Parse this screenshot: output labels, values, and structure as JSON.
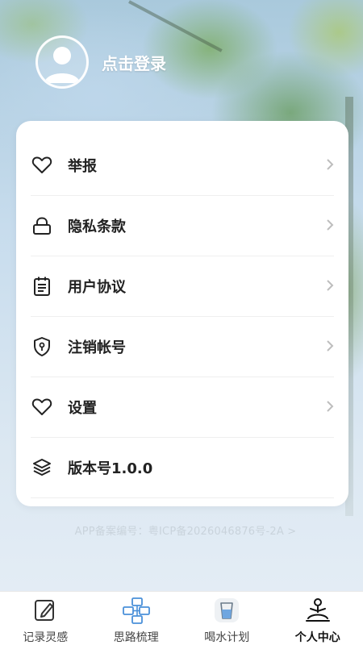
{
  "header": {
    "login_text": "点击登录"
  },
  "menu": {
    "items": [
      {
        "label": "举报",
        "icon": "heart-icon"
      },
      {
        "label": "隐私条款",
        "icon": "lock-icon"
      },
      {
        "label": "用户协议",
        "icon": "clipboard-icon"
      },
      {
        "label": "注销帐号",
        "icon": "shield-icon"
      },
      {
        "label": "设置",
        "icon": "heart-icon"
      },
      {
        "label": "版本号1.0.0",
        "icon": "layers-icon"
      }
    ]
  },
  "footer": {
    "icp_text": "APP备案编号：粤ICP备2026046876号-2A >"
  },
  "tabbar": {
    "tabs": [
      {
        "label": "记录灵感",
        "icon": "note-pencil-icon"
      },
      {
        "label": "思路梳理",
        "icon": "mindmap-icon"
      },
      {
        "label": "喝水计划",
        "icon": "water-cup-icon"
      },
      {
        "label": "个人中心",
        "icon": "meditation-person-icon",
        "active": true
      }
    ]
  },
  "colors": {
    "card": "#ffffff",
    "text": "#222222",
    "accent_blue": "#4a90d9"
  }
}
